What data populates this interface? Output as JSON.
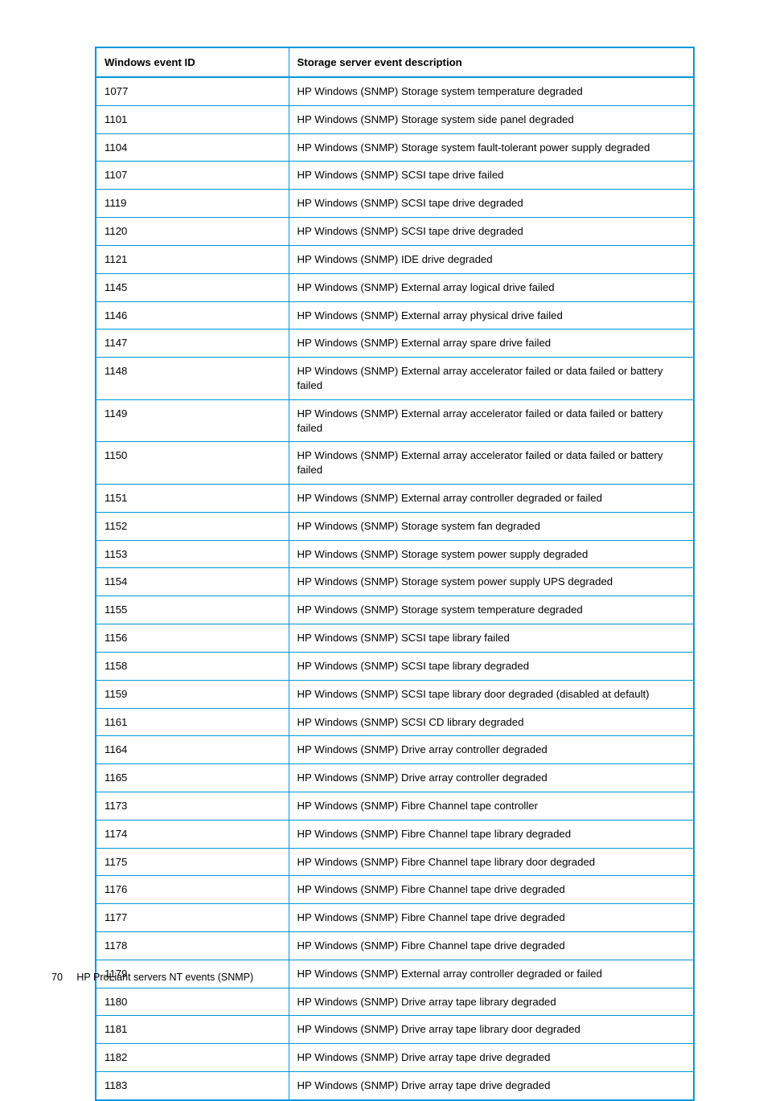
{
  "table": {
    "headers": {
      "id": "Windows event ID",
      "desc": "Storage server event description"
    },
    "rows": [
      {
        "id": "1077",
        "desc": "HP Windows (SNMP) Storage system temperature degraded"
      },
      {
        "id": "1101",
        "desc": "HP Windows (SNMP) Storage system side panel degraded"
      },
      {
        "id": "1104",
        "desc": "HP Windows (SNMP) Storage system fault-tolerant power supply degraded"
      },
      {
        "id": "1107",
        "desc": "HP Windows (SNMP) SCSI tape drive failed"
      },
      {
        "id": "1119",
        "desc": "HP Windows (SNMP) SCSI tape drive degraded"
      },
      {
        "id": "1120",
        "desc": "HP Windows (SNMP) SCSI tape drive degraded"
      },
      {
        "id": "1121",
        "desc": "HP Windows (SNMP) IDE drive degraded"
      },
      {
        "id": "1145",
        "desc": "HP Windows (SNMP) External array logical drive failed"
      },
      {
        "id": "1146",
        "desc": "HP Windows (SNMP) External array physical drive failed"
      },
      {
        "id": "1147",
        "desc": "HP Windows (SNMP) External array spare drive failed"
      },
      {
        "id": "1148",
        "desc": "HP Windows (SNMP) External array accelerator failed or data failed or battery failed"
      },
      {
        "id": "1149",
        "desc": "HP Windows (SNMP) External array accelerator failed or data failed or battery failed"
      },
      {
        "id": "1150",
        "desc": "HP Windows (SNMP) External array accelerator failed or data failed or battery failed"
      },
      {
        "id": "1151",
        "desc": "HP Windows (SNMP) External array controller degraded or failed"
      },
      {
        "id": "1152",
        "desc": "HP Windows (SNMP) Storage system fan degraded"
      },
      {
        "id": "1153",
        "desc": "HP Windows (SNMP) Storage system power supply degraded"
      },
      {
        "id": "1154",
        "desc": "HP Windows (SNMP) Storage system power supply UPS degraded"
      },
      {
        "id": "1155",
        "desc": "HP Windows (SNMP) Storage system temperature degraded"
      },
      {
        "id": "1156",
        "desc": "HP Windows (SNMP) SCSI tape library failed"
      },
      {
        "id": "1158",
        "desc": "HP Windows (SNMP) SCSI tape library degraded"
      },
      {
        "id": "1159",
        "desc": "HP Windows (SNMP) SCSI tape library door degraded (disabled at default)"
      },
      {
        "id": "1161",
        "desc": "HP Windows (SNMP) SCSI CD library degraded"
      },
      {
        "id": "1164",
        "desc": "HP Windows (SNMP) Drive array controller degraded"
      },
      {
        "id": "1165",
        "desc": "HP Windows (SNMP) Drive array controller degraded"
      },
      {
        "id": "1173",
        "desc": "HP Windows (SNMP) Fibre Channel tape controller"
      },
      {
        "id": "1174",
        "desc": "HP Windows (SNMP) Fibre Channel tape library degraded"
      },
      {
        "id": "1175",
        "desc": "HP Windows (SNMP) Fibre Channel tape library door degraded"
      },
      {
        "id": "1176",
        "desc": "HP Windows (SNMP) Fibre Channel tape drive degraded"
      },
      {
        "id": "1177",
        "desc": "HP Windows (SNMP) Fibre Channel tape drive degraded"
      },
      {
        "id": "1178",
        "desc": "HP Windows (SNMP) Fibre Channel tape drive degraded"
      },
      {
        "id": "1179",
        "desc": "HP Windows (SNMP) External array controller degraded or failed"
      },
      {
        "id": "1180",
        "desc": "HP Windows (SNMP) Drive array tape library degraded"
      },
      {
        "id": "1181",
        "desc": "HP Windows (SNMP) Drive array tape library door degraded"
      },
      {
        "id": "1182",
        "desc": "HP Windows (SNMP) Drive array tape drive degraded"
      },
      {
        "id": "1183",
        "desc": "HP Windows (SNMP) Drive array tape drive degraded"
      }
    ]
  },
  "footer": {
    "page_number": "70",
    "section_title": "HP ProLiant servers NT events (SNMP)"
  }
}
